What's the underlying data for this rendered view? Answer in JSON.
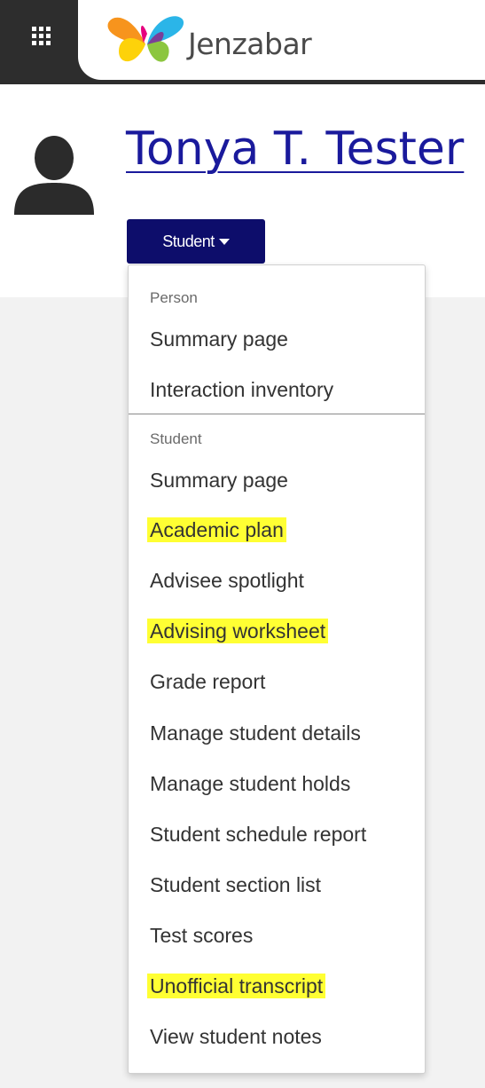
{
  "topbar": {
    "apps_icon": "grid-icon",
    "logo_text": "Jenzabar",
    "logo_icon": "butterfly-logo-icon"
  },
  "header": {
    "avatar_icon": "person-silhouette-icon",
    "person_name": "Tonya T. Tester",
    "role_button": "Student",
    "role_caret_icon": "caret-down-icon"
  },
  "menu": {
    "groups": [
      {
        "label": "Person",
        "items": [
          {
            "label": "Summary page",
            "highlighted": false
          },
          {
            "label": "Interaction inventory",
            "highlighted": false
          }
        ]
      },
      {
        "label": "Student",
        "items": [
          {
            "label": "Summary page",
            "highlighted": false
          },
          {
            "label": "Academic plan",
            "highlighted": true
          },
          {
            "label": "Advisee spotlight",
            "highlighted": false
          },
          {
            "label": "Advising worksheet",
            "highlighted": true
          },
          {
            "label": "Grade report",
            "highlighted": false
          },
          {
            "label": "Manage student details",
            "highlighted": false
          },
          {
            "label": "Manage student holds",
            "highlighted": false
          },
          {
            "label": "Student schedule report",
            "highlighted": false
          },
          {
            "label": "Student section list",
            "highlighted": false
          },
          {
            "label": "Test scores",
            "highlighted": false
          },
          {
            "label": "Unofficial transcript",
            "highlighted": true
          },
          {
            "label": "View student notes",
            "highlighted": false
          }
        ]
      }
    ]
  },
  "colors": {
    "topbar": "#2d2d2d",
    "name_link": "#1a1a9c",
    "role_button_bg": "#0d0d6b",
    "highlight": "#ffff33"
  }
}
